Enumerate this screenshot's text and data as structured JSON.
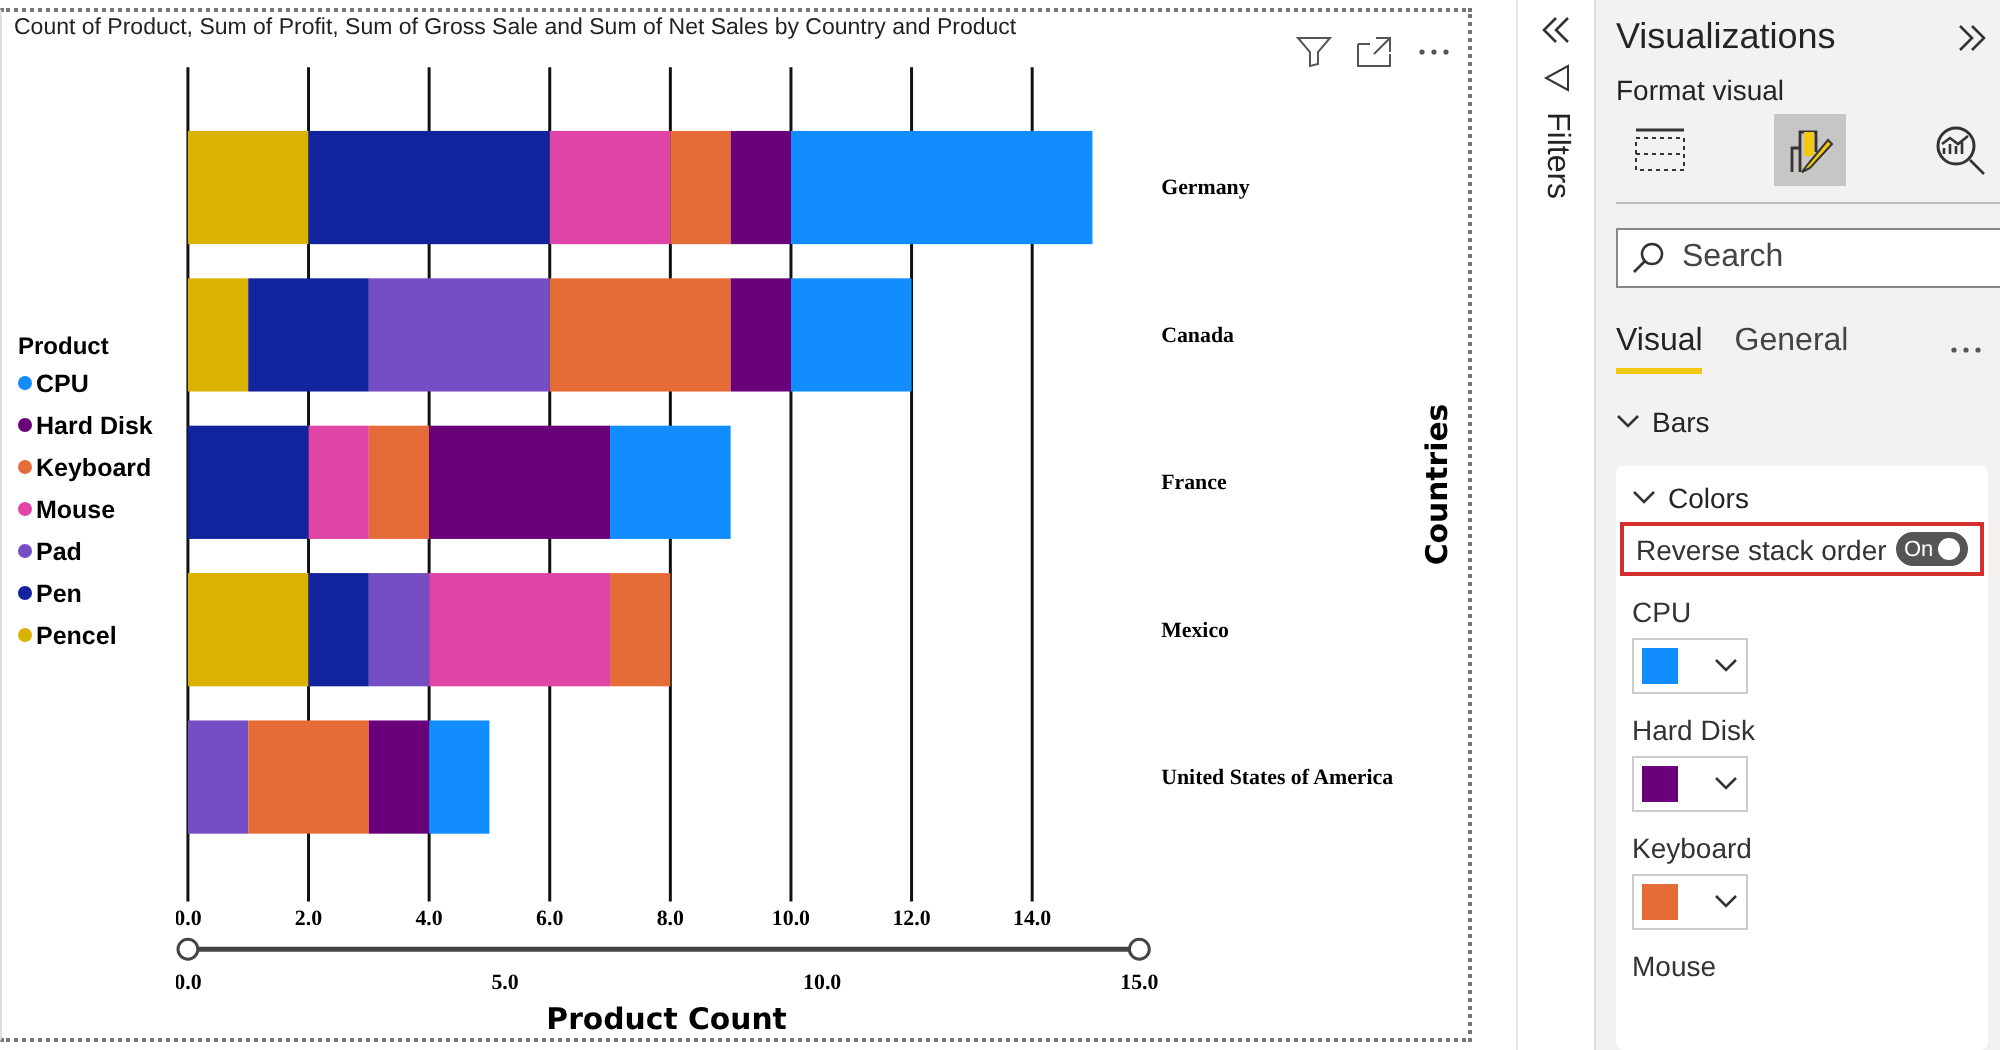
{
  "visual": {
    "title": "Count of Product, Sum of Profit, Sum of Gross Sale and Sum of Net Sales by Country and Product",
    "legend": {
      "title": "Product"
    },
    "chart_data": {
      "type": "bar",
      "orientation": "horizontal",
      "stacked": true,
      "grid": true,
      "xlabel": "Product Count",
      "ylabel": "Countries",
      "categories": [
        "Germany",
        "Canada",
        "France",
        "Mexico",
        "United States of America"
      ],
      "series": [
        {
          "name": "CPU",
          "color": "#118dff",
          "values": [
            5,
            2,
            2,
            0,
            1
          ]
        },
        {
          "name": "Hard Disk",
          "color": "#6b007b",
          "values": [
            1,
            1,
            3,
            0,
            1
          ]
        },
        {
          "name": "Keyboard",
          "color": "#e66c37",
          "values": [
            1,
            3,
            1,
            1,
            2
          ]
        },
        {
          "name": "Mouse",
          "color": "#e044a7",
          "values": [
            2,
            0,
            1,
            3,
            0
          ]
        },
        {
          "name": "Pad",
          "color": "#744ec2",
          "values": [
            0,
            3,
            0,
            1,
            1
          ]
        },
        {
          "name": "Pen",
          "color": "#12239e",
          "values": [
            4,
            2,
            2,
            1,
            0
          ]
        },
        {
          "name": "Pencel",
          "color": "#d9b300",
          "values": [
            2,
            1,
            0,
            2,
            0
          ]
        }
      ],
      "xlim": [
        0,
        15
      ],
      "xticks": [
        {
          "value": 0,
          "label": "0.0"
        },
        {
          "value": 2,
          "label": "2.0"
        },
        {
          "value": 4,
          "label": "4.0"
        },
        {
          "value": 6,
          "label": "6.0"
        },
        {
          "value": 8,
          "label": "8.0"
        },
        {
          "value": 10,
          "label": "10.0"
        },
        {
          "value": 12,
          "label": "12.0"
        },
        {
          "value": 14,
          "label": "14.0"
        }
      ]
    },
    "range_slider": {
      "labels": [
        "0.0",
        "5.0",
        "10.0",
        "15.0"
      ]
    }
  },
  "filters": {
    "label": "Filters"
  },
  "pane": {
    "title": "Visualizations",
    "subtitle": "Format visual",
    "format_tabs": [
      {
        "kind": "build",
        "selected": false
      },
      {
        "kind": "format",
        "selected": true
      },
      {
        "kind": "analytics",
        "selected": false
      }
    ],
    "search": {
      "placeholder": "Search"
    },
    "tabs": [
      {
        "label": "Visual",
        "selected": true
      },
      {
        "label": "General",
        "selected": false
      }
    ],
    "section": {
      "label": "Bars",
      "expanded": true
    },
    "card": {
      "label": "Colors",
      "expanded": true,
      "toggle": {
        "label": "Reverse stack order",
        "on": true,
        "state_label": "On"
      },
      "colors": [
        {
          "label": "CPU",
          "color": "#118dff"
        },
        {
          "label": "Hard Disk",
          "color": "#6b007b"
        },
        {
          "label": "Keyboard",
          "color": "#e66c37"
        },
        {
          "label": "Mouse"
        }
      ]
    }
  }
}
